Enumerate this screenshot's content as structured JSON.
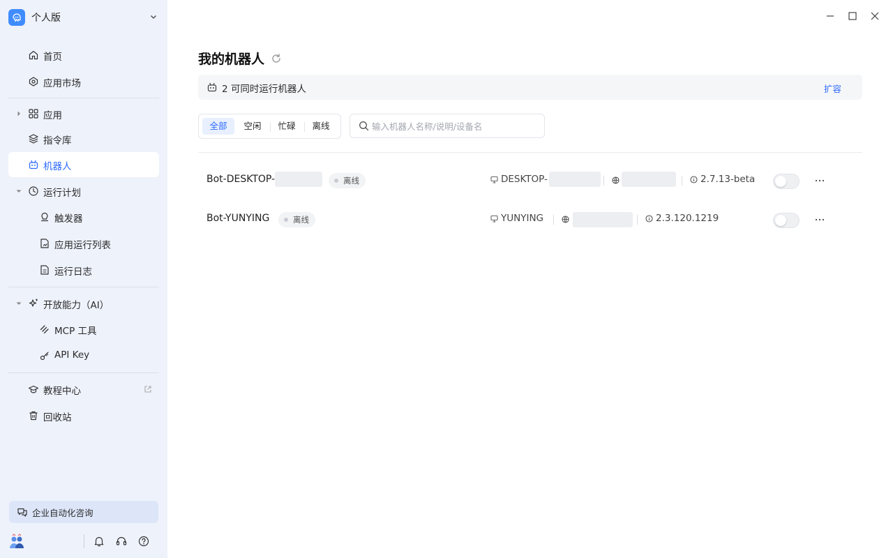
{
  "sidebar": {
    "workspace": "个人版",
    "items": {
      "home": "首页",
      "market": "应用市场",
      "apps": "应用",
      "commands": "指令库",
      "robots": "机器人",
      "schedule": "运行计划",
      "trigger": "触发器",
      "app_run_list": "应用运行列表",
      "run_log": "运行日志",
      "open_ability": "开放能力（AI）",
      "mcp": "MCP 工具",
      "api_key": "API Key",
      "tutorial": "教程中心",
      "recycle": "回收站"
    },
    "consult": "企业自动化咨询"
  },
  "main": {
    "title": "我的机器人",
    "banner_text": "2 可同时运行机器人",
    "banner_action": "扩容",
    "filters": [
      "全部",
      "空闲",
      "忙碌",
      "离线"
    ],
    "search_placeholder": "输入机器人名称/说明/设备名",
    "bots": [
      {
        "name": "Bot-DESKTOP-",
        "status": "离线",
        "device": "DESKTOP-",
        "version": "2.7.13-beta"
      },
      {
        "name": "Bot-YUNYING",
        "status": "离线",
        "device": "YUNYING",
        "version": "2.3.120.1219"
      }
    ]
  },
  "colors": {
    "accent": "#2f6bff",
    "sidebar_bg": "#eef2fb",
    "logo": "#3f8cff"
  },
  "icons": [
    "home-icon",
    "market-icon",
    "apps-icon",
    "layers-icon",
    "robot-icon",
    "clock-icon",
    "trigger-icon",
    "list-icon",
    "log-icon",
    "sparkle-icon",
    "mcp-icon",
    "key-icon",
    "graduation-icon",
    "trash-icon",
    "chat-icon",
    "bell-icon",
    "headset-icon",
    "help-icon",
    "refresh-icon",
    "search-icon",
    "monitor-icon",
    "globe-icon",
    "info-icon",
    "more-icon"
  ]
}
